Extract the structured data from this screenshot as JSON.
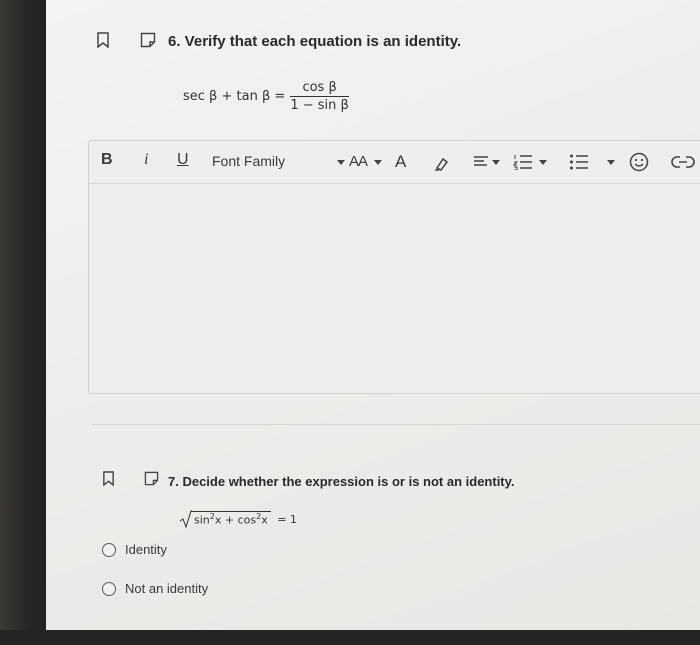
{
  "question6": {
    "number_title": "6. Verify that each equation is an identity.",
    "equation_lhs": "sec β + tan β =",
    "equation_numerator": "cos β",
    "equation_denominator": "1 − sin β"
  },
  "editor": {
    "toolbar": {
      "bold": "B",
      "italic": "i",
      "underline": "U",
      "font_family": "Font Family",
      "font_size": "AA",
      "font_color": "A"
    }
  },
  "question7": {
    "number_title": "7. Decide whether the expression is or is not an identity.",
    "expression_sin": "sin",
    "expression_x1": "x + cos",
    "expression_x2": "x",
    "exponent": "2",
    "expression_rhs": "= 1",
    "options": [
      {
        "label": "Identity"
      },
      {
        "label": "Not an identity"
      }
    ]
  },
  "icons": [
    "bookmark-icon",
    "note-icon",
    "chevron-down-icon",
    "text-color-icon",
    "highlighter-icon",
    "align-icon",
    "numbered-list-icon",
    "bullet-list-icon",
    "emoji-icon",
    "link-icon"
  ],
  "colors": {
    "screen_bg": "#eeedeb",
    "text": "#2a2a2a",
    "border": "#d2d1ce"
  }
}
